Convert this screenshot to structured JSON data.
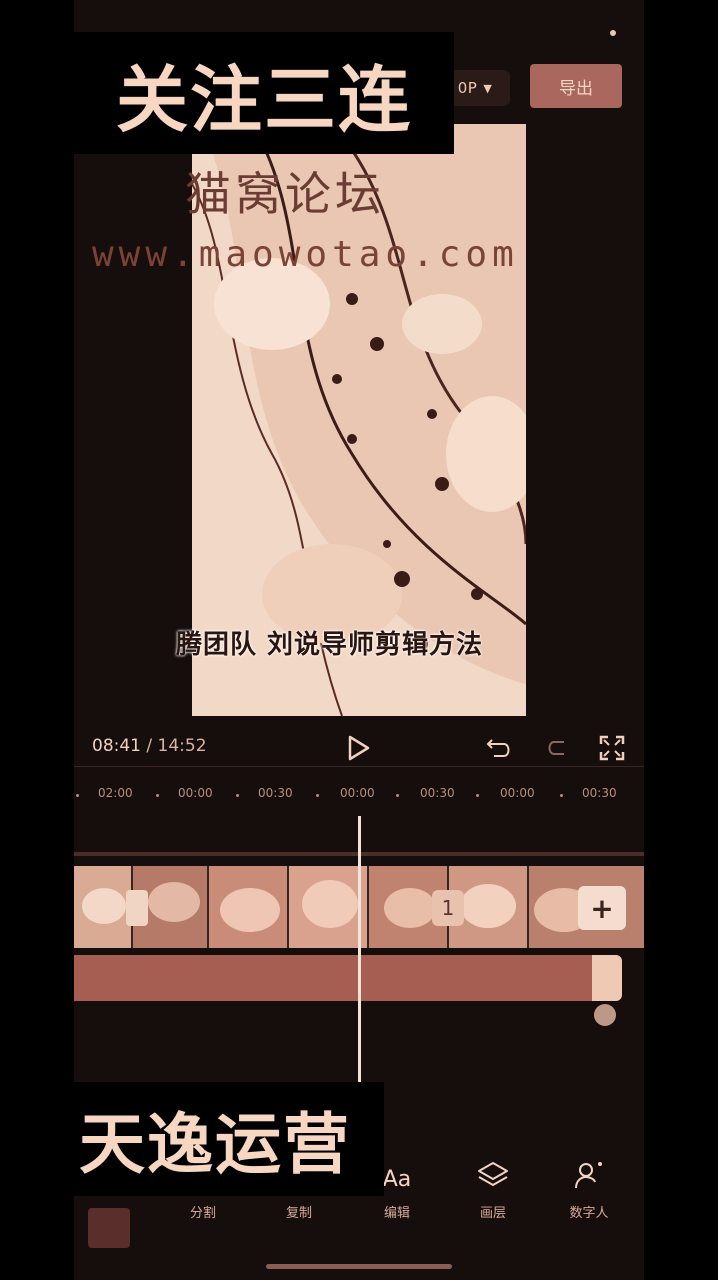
{
  "header": {
    "resolution_label": "0P",
    "export_label": "导出"
  },
  "preview": {
    "watermark_title": "猫窝论坛",
    "watermark_url": "www.maowotao.com",
    "subtitle": "腾团队 刘说导师剪辑方法"
  },
  "player": {
    "current_time": "08:41",
    "separator": " / ",
    "total_time": "14:52"
  },
  "ruler": {
    "ticks": [
      "02:00",
      "00:00",
      "00:30",
      "00:00",
      "00:30",
      "00:00",
      "00:30"
    ]
  },
  "toolbar": {
    "items": [
      {
        "label": "分割",
        "icon": "split-icon"
      },
      {
        "label": "复制",
        "icon": "copy-icon"
      },
      {
        "label": "编辑",
        "icon": "text-icon"
      },
      {
        "label": "画层",
        "icon": "layers-icon"
      },
      {
        "label": "数字人",
        "icon": "digital-human-icon"
      }
    ],
    "text_icon_glyph": "Aa"
  },
  "overlays": {
    "top_text": "关注三连",
    "bottom_text": "天逸运营"
  },
  "timeline": {
    "add_button_label": "+",
    "split_marker_label": "1"
  },
  "colors": {
    "accent": "#a9675e",
    "audio_track": "#a65e52",
    "background": "#160d0d"
  }
}
